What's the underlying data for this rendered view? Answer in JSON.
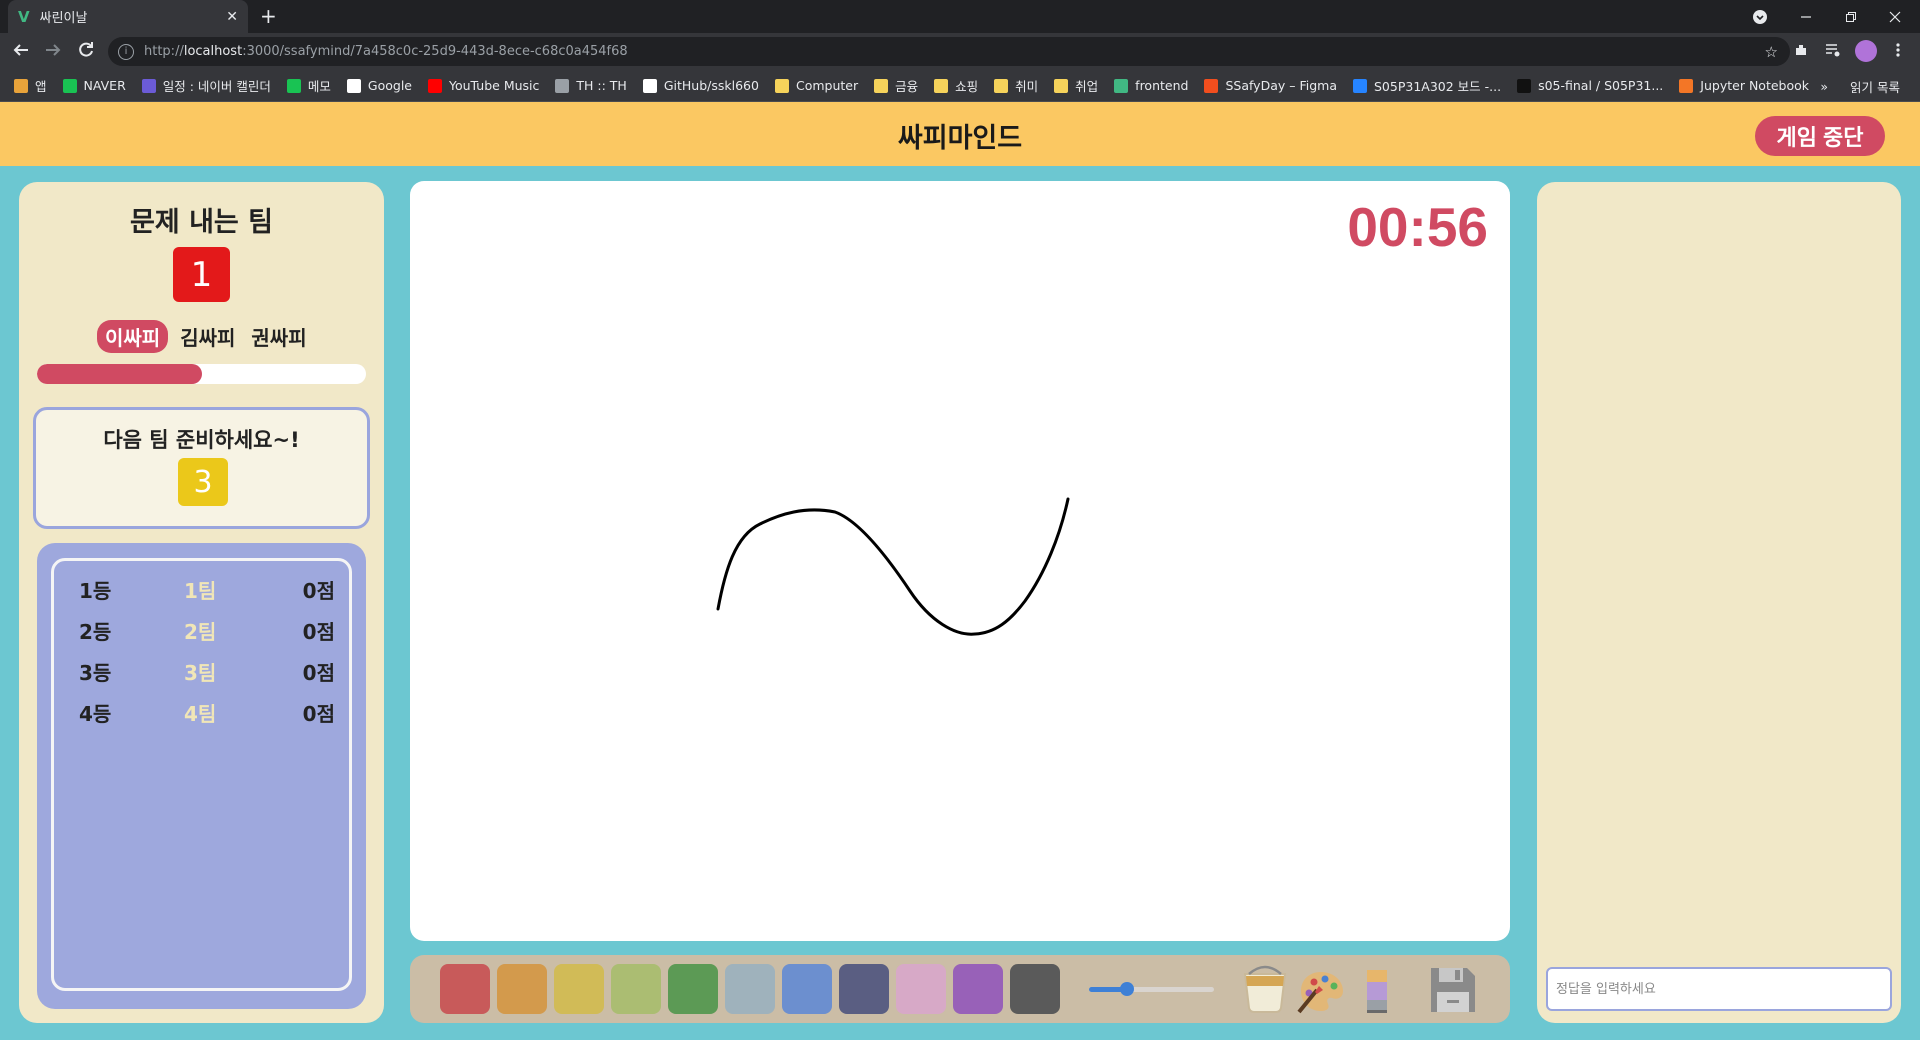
{
  "browser": {
    "tab_title": "싸린이날",
    "tab_favicon": "V",
    "close_glyph": "✕",
    "newtab_glyph": "+",
    "url_prefix": "http://",
    "url_host": "localhost",
    "url_rest": ":3000/ssafymind/7a458c0c-25d9-443d-8ece-c68c0a454f68",
    "bookmarks": [
      {
        "label": "앱",
        "color": "#e8a33a"
      },
      {
        "label": "NAVER",
        "color": "#19c353"
      },
      {
        "label": "일정 : 네이버 캘린더",
        "color": "#6b5bd6"
      },
      {
        "label": "메모",
        "color": "#19c353"
      },
      {
        "label": "Google",
        "color": "#ffffff"
      },
      {
        "label": "YouTube Music",
        "color": "#ff0000"
      },
      {
        "label": "TH :: TH",
        "color": "#9aa0a6"
      },
      {
        "label": "GitHub/sskl660",
        "color": "#ffffff"
      },
      {
        "label": "Computer",
        "color": "#f6d35b"
      },
      {
        "label": "금융",
        "color": "#f6d35b"
      },
      {
        "label": "쇼핑",
        "color": "#f6d35b"
      },
      {
        "label": "취미",
        "color": "#f6d35b"
      },
      {
        "label": "취업",
        "color": "#f6d35b"
      },
      {
        "label": "frontend",
        "color": "#41b883"
      },
      {
        "label": "SSafyDay – Figma",
        "color": "#f24e1e"
      },
      {
        "label": "S05P31A302 보드 -...",
        "color": "#2684ff"
      },
      {
        "label": "s05-final / S05P31...",
        "color": "#111111"
      },
      {
        "label": "Jupyter Notebook",
        "color": "#f37626"
      }
    ],
    "bookmarks_more": "»",
    "reading_list": "읽기 목록"
  },
  "app": {
    "title": "싸피마인드",
    "stop_button": "게임 중단"
  },
  "left": {
    "team_title": "문제 내는 팀",
    "team_number": "1",
    "members": [
      "이싸피",
      "김싸피",
      "권싸피"
    ],
    "progress_fraction": 0.5,
    "next_title": "다음 팀 준비하세요~!",
    "next_team_number": "3",
    "rankings": [
      {
        "rank": "1등",
        "team": "1팀",
        "score": "0점"
      },
      {
        "rank": "2등",
        "team": "2팀",
        "score": "0점"
      },
      {
        "rank": "3등",
        "team": "3팀",
        "score": "0점"
      },
      {
        "rank": "4등",
        "team": "4팀",
        "score": "0점"
      }
    ]
  },
  "canvas": {
    "timer": "00:56"
  },
  "palette": {
    "colors": [
      "#c85a5a",
      "#d39a4c",
      "#d1bb57",
      "#abbd72",
      "#5c9a55",
      "#9fb2bc",
      "#6c8fcf",
      "#5a5e82",
      "#d7a9c7",
      "#9861b8",
      "#5a5a5a"
    ],
    "brush_size_fraction": 0.3,
    "tools": [
      "paint-bucket-icon",
      "palette-icon",
      "eraser-icon",
      "save-icon"
    ]
  },
  "right": {
    "answer_placeholder": "정답을 입력하세요"
  }
}
